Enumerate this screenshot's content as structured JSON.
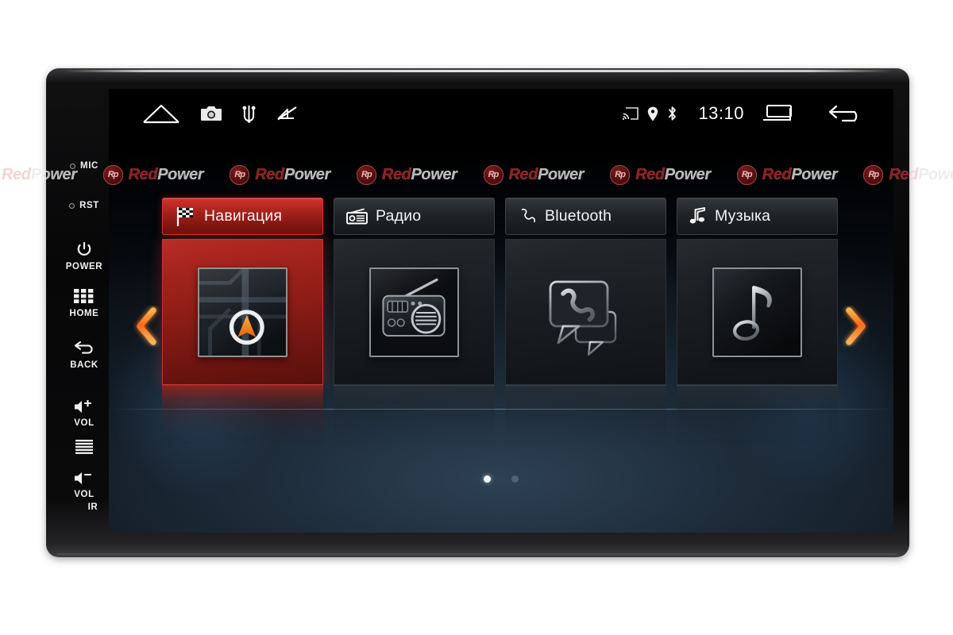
{
  "watermark": {
    "text_red": "Red",
    "text_gray": "Power",
    "badge_text": "Rp",
    "repeat": 13
  },
  "device": {
    "bezel_buttons": [
      {
        "name": "mic",
        "label": "MIC",
        "type": "pin-label"
      },
      {
        "name": "reset",
        "label": "RST",
        "type": "pin-label"
      },
      {
        "name": "power",
        "label": "POWER",
        "type": "icon-label",
        "icon": "power-icon"
      },
      {
        "name": "home",
        "label": "HOME",
        "type": "icon-label",
        "icon": "grid-icon"
      },
      {
        "name": "back",
        "label": "BACK",
        "type": "icon-label",
        "icon": "back-arrow-icon"
      },
      {
        "name": "volume-up",
        "label": "VOL",
        "type": "icon-label",
        "icon": "speaker-plus-icon"
      },
      {
        "name": "menu-lines",
        "label": "",
        "type": "icon",
        "icon": "lines-icon"
      },
      {
        "name": "volume-down",
        "label": "VOL",
        "type": "icon-label",
        "icon": "speaker-minus-icon"
      },
      {
        "name": "ir-receiver",
        "label": "IR",
        "type": "label"
      }
    ]
  },
  "statusbar": {
    "left_icons": [
      {
        "name": "home-icon",
        "label": "home"
      },
      {
        "name": "camera-icon",
        "label": "camera"
      },
      {
        "name": "usb-icon",
        "label": "usb"
      },
      {
        "name": "mute-icon",
        "label": "sound off"
      }
    ],
    "right_icons": [
      {
        "name": "cast-icon",
        "label": "cast"
      },
      {
        "name": "location-pin-icon",
        "label": "location"
      },
      {
        "name": "bluetooth-icon",
        "label": "bluetooth"
      }
    ],
    "clock": "13:10",
    "recents_icon": "recents-icon",
    "back_icon": "back-icon"
  },
  "carousel": {
    "prev_label": "‹",
    "next_label": "›",
    "cards": [
      {
        "id": "navigation",
        "label": "Навигация",
        "tab_icon": "checkered-flag-icon",
        "tile_icon": "map-navigation-icon",
        "active": true
      },
      {
        "id": "radio",
        "label": "Радио",
        "tab_icon": "radio-icon",
        "tile_icon": "radio-receiver-icon",
        "active": false
      },
      {
        "id": "bluetooth",
        "label": "Bluetooth",
        "tab_icon": "phone-handset-icon",
        "tile_icon": "chat-phone-icon",
        "active": false
      },
      {
        "id": "music",
        "label": "Музыка",
        "tab_icon": "music-note-icon",
        "tile_icon": "music-note-tile-icon",
        "active": false
      }
    ],
    "page_dots": [
      {
        "active": true
      },
      {
        "active": false
      }
    ]
  },
  "colors": {
    "accent_red": "#c9332b",
    "accent_orange": "#ff7b22",
    "screen_blue": "#2d4154",
    "text_white": "#f4f5f6"
  }
}
